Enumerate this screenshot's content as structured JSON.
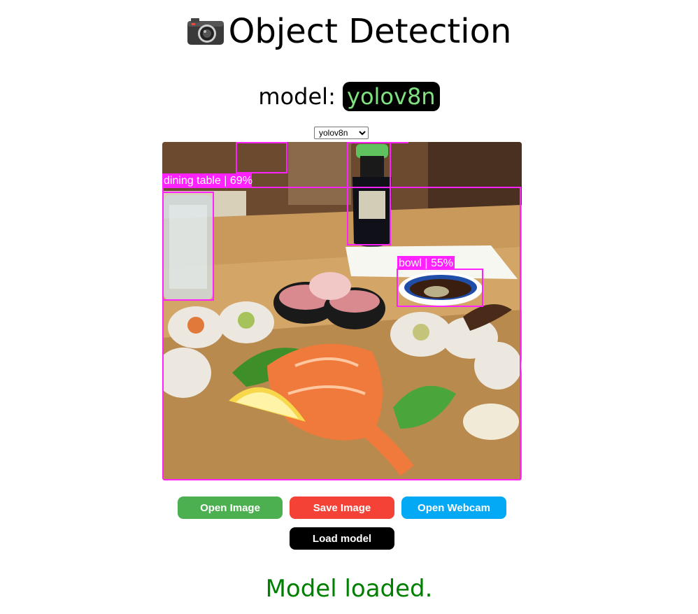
{
  "app": {
    "title": "Object Detection",
    "title_icon": "camera-icon",
    "model_prefix": "model:",
    "model_name": "yolov8n"
  },
  "model_select": {
    "selected": "yolov8n",
    "options": [
      "yolov8n"
    ]
  },
  "detections": [
    {
      "label": "dining table | 69%"
    },
    {
      "label": "bowl | 55%"
    }
  ],
  "buttons": {
    "open_image": "Open Image",
    "save_image": "Save Image",
    "open_webcam": "Open Webcam",
    "load_model": "Load model"
  },
  "colors": {
    "box": "#ff22ff",
    "open_image": "#4caf50",
    "save_image": "#f44336",
    "open_webcam": "#03a9f4",
    "load_model": "#000000",
    "status": "#008000",
    "model_name": "#7ee27e"
  },
  "status": "Model loaded."
}
